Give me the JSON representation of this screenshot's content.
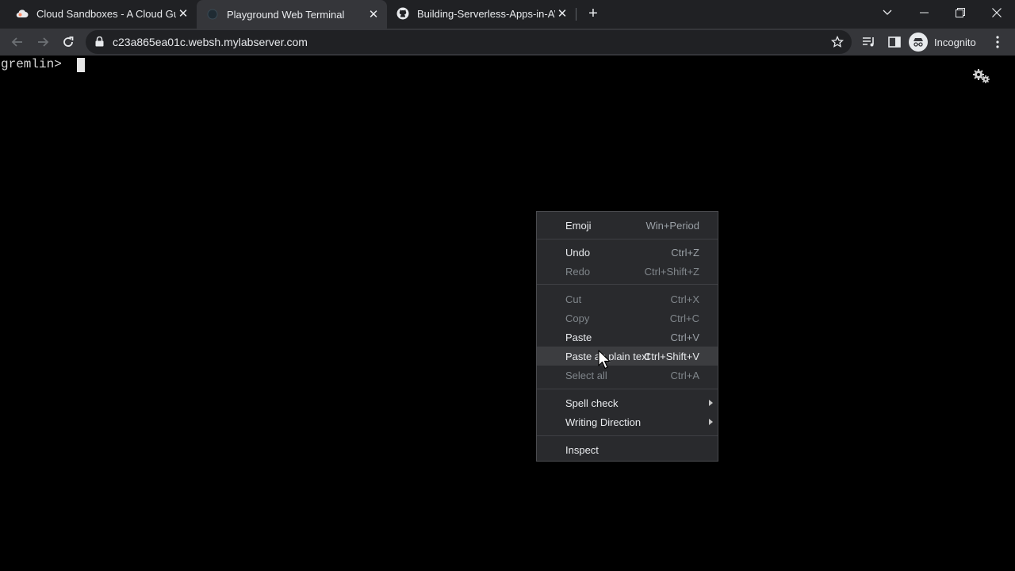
{
  "tabs": [
    {
      "title": "Cloud Sandboxes - A Cloud Guru",
      "icon": "cloud-icon"
    },
    {
      "title": "Playground Web Terminal",
      "icon": "terminal-favicon-icon"
    },
    {
      "title": "Building-Serverless-Apps-in-AWS",
      "icon": "github-icon"
    }
  ],
  "toolbar": {
    "url": "c23a865ea01c.websh.mylabserver.com",
    "profile_label": "Incognito"
  },
  "terminal": {
    "prompt": "gremlin> "
  },
  "context_menu": {
    "items": [
      {
        "label": "Emoji",
        "shortcut": "Win+Period",
        "enabled": true
      },
      {
        "label": "Undo",
        "shortcut": "Ctrl+Z",
        "enabled": true
      },
      {
        "label": "Redo",
        "shortcut": "Ctrl+Shift+Z",
        "enabled": false
      },
      {
        "label": "Cut",
        "shortcut": "Ctrl+X",
        "enabled": false
      },
      {
        "label": "Copy",
        "shortcut": "Ctrl+C",
        "enabled": false
      },
      {
        "label": "Paste",
        "shortcut": "Ctrl+V",
        "enabled": true
      },
      {
        "label": "Paste as plain text",
        "shortcut": "Ctrl+Shift+V",
        "enabled": true,
        "hovered": true
      },
      {
        "label": "Select all",
        "shortcut": "Ctrl+A",
        "enabled": false
      },
      {
        "label": "Spell check",
        "submenu": true,
        "enabled": true
      },
      {
        "label": "Writing Direction",
        "submenu": true,
        "enabled": true
      },
      {
        "label": "Inspect",
        "enabled": true
      }
    ]
  },
  "colors": {
    "tabstrip_bg": "#202124",
    "toolbar_bg": "#35363a",
    "menu_bg": "#292a2d",
    "menu_hover": "#3c3d40",
    "terminal_bg": "#000000"
  }
}
